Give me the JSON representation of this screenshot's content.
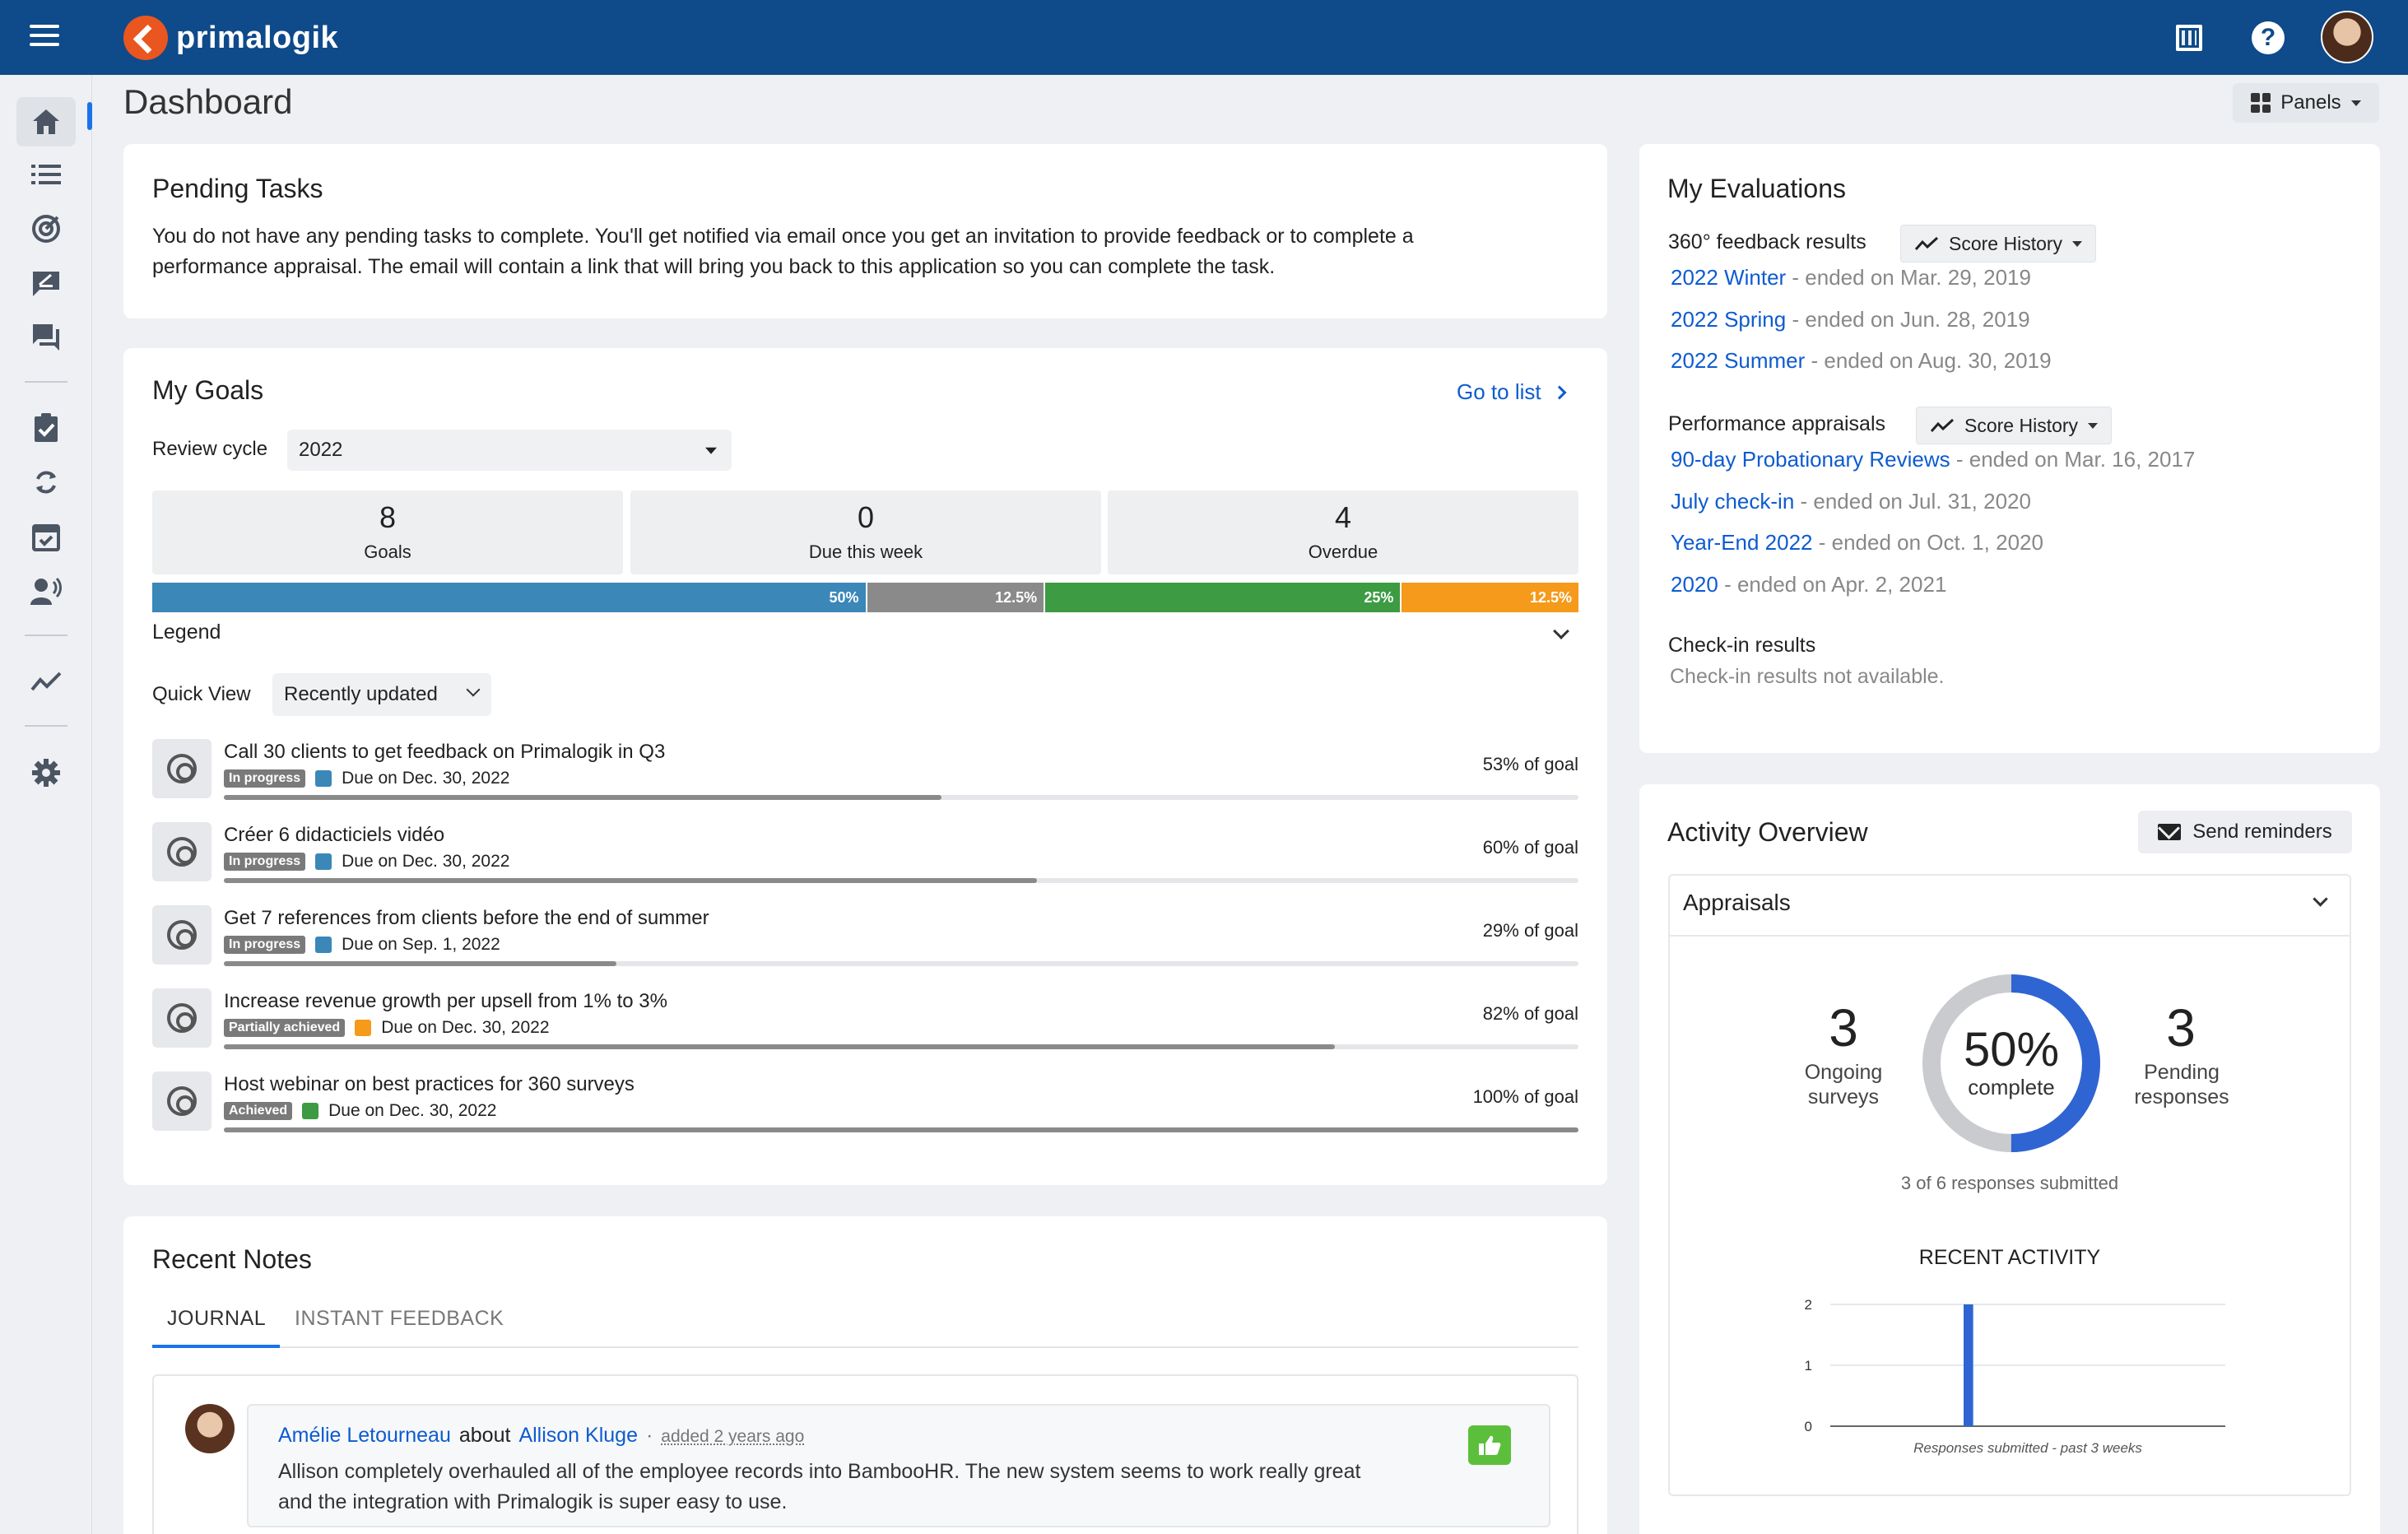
{
  "app": {
    "brand": "primalogik"
  },
  "colors": {
    "topbar": "#0f4a8a",
    "link": "#0d5bd1",
    "blue": "#3a87b8",
    "grey": "#8a8a8a",
    "green": "#3c9b43",
    "orange": "#f59a1a",
    "accent": "#1a73e8",
    "donut_blue": "#2f64d3"
  },
  "icons": {
    "nav": [
      "home-icon",
      "list-icon",
      "target-icon",
      "feedback-icon",
      "chat-icon",
      "clipboard-check-icon",
      "sync-icon",
      "calendar-check-icon",
      "speaker-icon",
      "trend-icon",
      "gear-icon"
    ],
    "top": [
      "menu-icon",
      "building-icon",
      "help-icon",
      "user-avatar"
    ]
  },
  "header": {
    "title": "Dashboard",
    "panels_label": "Panels"
  },
  "pending": {
    "title": "Pending Tasks",
    "text_line1": "You do not have any pending tasks to complete. You'll get notified via email once you get an invitation to provide feedback or to complete a",
    "text_line2": "performance appraisal. The email will contain a link that will bring you back to this application so you can complete the task."
  },
  "goals": {
    "title": "My Goals",
    "go_to_list": "Go to list",
    "review_cycle_label": "Review cycle",
    "review_cycle_value": "2022",
    "stats": [
      {
        "value": "8",
        "label": "Goals"
      },
      {
        "value": "0",
        "label": "Due this week"
      },
      {
        "value": "4",
        "label": "Overdue"
      }
    ],
    "progress_segments": [
      {
        "label": "50%",
        "fraction": 0.5,
        "color": "#3a87b8"
      },
      {
        "label": "12.5%",
        "fraction": 0.125,
        "color": "#8a8a8a"
      },
      {
        "label": "25%",
        "fraction": 0.25,
        "color": "#3c9b43"
      },
      {
        "label": "12.5%",
        "fraction": 0.125,
        "color": "#f59a1a"
      }
    ],
    "legend_label": "Legend",
    "quick_view_label": "Quick View",
    "quick_view_value": "Recently updated",
    "items": [
      {
        "title": "Call 30 clients to get feedback on Primalogik in Q3",
        "status": "In progress",
        "status_color": "#3a87b8",
        "due": "Due on Dec. 30, 2022",
        "pct_label": "53% of goal",
        "pct": 0.53
      },
      {
        "title": "Créer 6 didacticiels vidéo",
        "status": "In progress",
        "status_color": "#3a87b8",
        "due": "Due on Dec. 30, 2022",
        "pct_label": "60% of goal",
        "pct": 0.6
      },
      {
        "title": "Get 7 references from clients before the end of summer",
        "status": "In progress",
        "status_color": "#3a87b8",
        "due": "Due on Sep. 1, 2022",
        "pct_label": "29% of goal",
        "pct": 0.29
      },
      {
        "title": "Increase revenue growth per upsell from 1% to 3%",
        "status": "Partially achieved",
        "status_color": "#f59a1a",
        "due": "Due on Dec. 30, 2022",
        "pct_label": "82% of goal",
        "pct": 0.82
      },
      {
        "title": "Host webinar on best practices for 360 surveys",
        "status": "Achieved",
        "status_color": "#3c9b43",
        "due": "Due on Dec. 30, 2022",
        "pct_label": "100% of goal",
        "pct": 1.0
      }
    ]
  },
  "notes": {
    "title": "Recent Notes",
    "tabs": [
      "JOURNAL",
      "INSTANT FEEDBACK"
    ],
    "note": {
      "author": "Amélie Letourneau",
      "about_word": "about",
      "subject": "Allison Kluge",
      "separator": "·",
      "time": "added 2 years ago",
      "text_line1": "Allison completely overhauled all of the employee records into BambooHR. The new system seems to work really great",
      "text_line2": "and the integration with Primalogik is super easy to use."
    }
  },
  "evaluations": {
    "title": "My Evaluations",
    "feedback_label": "360° feedback results",
    "score_history_label": "Score History",
    "feedback_items": [
      {
        "name": "2022 Winter",
        "date": "- ended on Mar. 29, 2019"
      },
      {
        "name": "2022 Spring",
        "date": "- ended on Jun. 28, 2019"
      },
      {
        "name": "2022 Summer",
        "date": "- ended on Aug. 30, 2019"
      }
    ],
    "appraisals_label": "Performance appraisals",
    "appraisal_items": [
      {
        "name": "90-day Probationary Reviews",
        "date": "- ended on Mar. 16, 2017"
      },
      {
        "name": "July check-in",
        "date": "- ended on Jul. 31, 2020"
      },
      {
        "name": "Year-End 2022",
        "date": "- ended on Oct. 1, 2020"
      },
      {
        "name": "2020",
        "date": "- ended on Apr. 2, 2021"
      }
    ],
    "checkin_label": "Check-in results",
    "checkin_empty": "Check-in results not available."
  },
  "activity": {
    "title": "Activity Overview",
    "send_reminders": "Send reminders",
    "accordion_label": "Appraisals",
    "ongoing_value": "3",
    "ongoing_label_1": "Ongoing",
    "ongoing_label_2": "surveys",
    "donut_pct": "50%",
    "donut_label": "complete",
    "donut_fraction": 0.5,
    "pending_value": "3",
    "pending_label_1": "Pending",
    "pending_label_2": "responses",
    "submitted_text": "3 of 6 responses submitted",
    "recent_title": "RECENT ACTIVITY"
  },
  "chart_data": {
    "type": "bar",
    "title": "RECENT ACTIVITY",
    "xlabel": "Responses submitted - past 3 weeks",
    "ylabel": "",
    "ylim": [
      0,
      2
    ],
    "yticks": [
      "0",
      "1",
      "2"
    ],
    "grid": true,
    "series": [
      {
        "values": [
          0,
          0,
          0,
          0,
          0,
          0,
          0,
          0,
          0,
          0,
          0,
          0,
          0,
          0,
          0,
          0,
          0,
          0,
          0,
          0,
          0,
          0,
          2,
          0,
          0,
          0,
          0,
          0,
          0,
          0,
          0,
          0,
          0,
          0,
          0,
          0,
          0,
          0,
          0,
          0,
          0,
          0,
          0,
          0,
          0,
          0,
          0,
          0,
          0,
          0,
          0,
          0,
          0,
          0,
          0,
          0,
          0,
          0,
          0,
          0,
          0,
          0,
          0,
          0,
          0,
          0
        ]
      }
    ]
  }
}
